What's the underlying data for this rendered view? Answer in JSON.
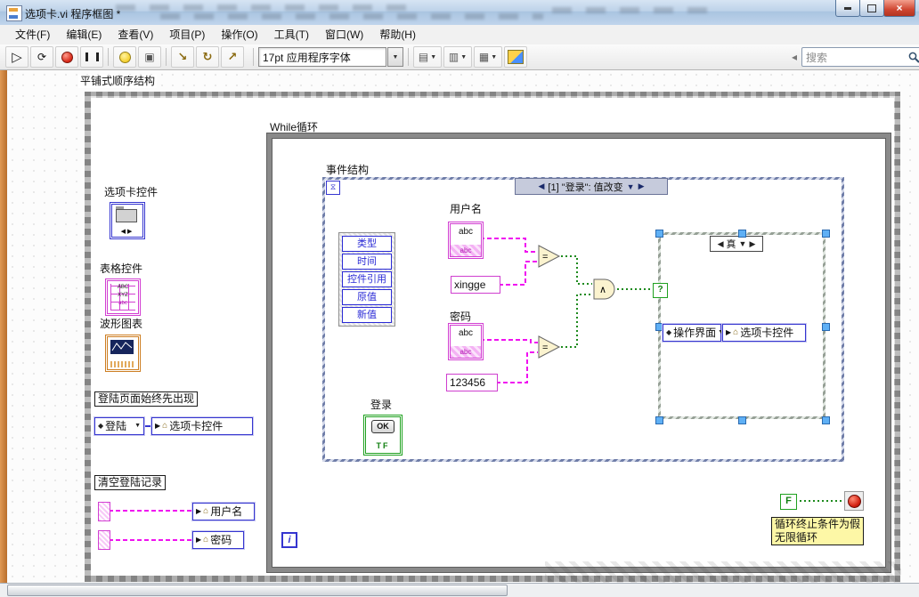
{
  "window": {
    "title": "选项卡.vi 程序框图 *"
  },
  "menu": {
    "items": [
      "文件(F)",
      "编辑(E)",
      "查看(V)",
      "项目(P)",
      "操作(O)",
      "工具(T)",
      "窗口(W)",
      "帮助(H)"
    ]
  },
  "toolbar": {
    "font_selector": "17pt 应用程序字体",
    "search_placeholder": "搜索"
  },
  "glyphs": {
    "run": "▷",
    "run_continuous": "⟳",
    "retain": "▣",
    "step_into": "↘",
    "step_over": "↻",
    "step_out": "↗",
    "dropdown": "▼",
    "left": "◀",
    "right": "▶",
    "diamond": "◆",
    "house": "⌂",
    "write": "▶",
    "close": "×",
    "question": "?",
    "hourglass": "⧖",
    "equal": "=",
    "and": "∧",
    "align": "▤",
    "distribute": "▥",
    "resize": "▦",
    "overflow": "◂"
  },
  "diagram": {
    "sequence_label": "平铺式顺序结构",
    "while_loop": {
      "label": "While循环",
      "iteration": "i",
      "false_constant": "F",
      "note_line1": "循环终止条件为假",
      "note_line2": "无限循环"
    },
    "event": {
      "label": "事件结构",
      "case_index_header": "[1] \"登录\": 值改变",
      "data_items": [
        "类型",
        "时间",
        "控件引用",
        "原值",
        "新值"
      ]
    },
    "username": {
      "label": "用户名",
      "terminal_text": "abc",
      "constant": "xingge"
    },
    "password": {
      "label": "密码",
      "terminal_text": "abc",
      "constant": "123456"
    },
    "login": {
      "label": "登录",
      "ok": "OK",
      "tf": "TF"
    },
    "case": {
      "header": "真",
      "enum_constant": "操作界面",
      "local_variable": "选项卡控件"
    },
    "left_panel": {
      "tab_label": "选项卡控件",
      "table_label": "表格控件",
      "table_icon_rows": [
        "ABC",
        "XYZ",
        "abc"
      ],
      "chart_label": "波形图表",
      "note_login_first": "登陆页面始终先出现",
      "enum_login": "登陆",
      "local_tab": "选项卡控件",
      "note_clear": "清空登陆记录",
      "local_user": "用户名",
      "local_pass": "密码"
    }
  },
  "colors": {
    "string_wire": "#F010F0",
    "boolean_wire": "#1D8A1D",
    "structure_blue": "#3535D0",
    "terminal_pink": "#D23FD2",
    "terminal_green": "#1FA11F"
  }
}
